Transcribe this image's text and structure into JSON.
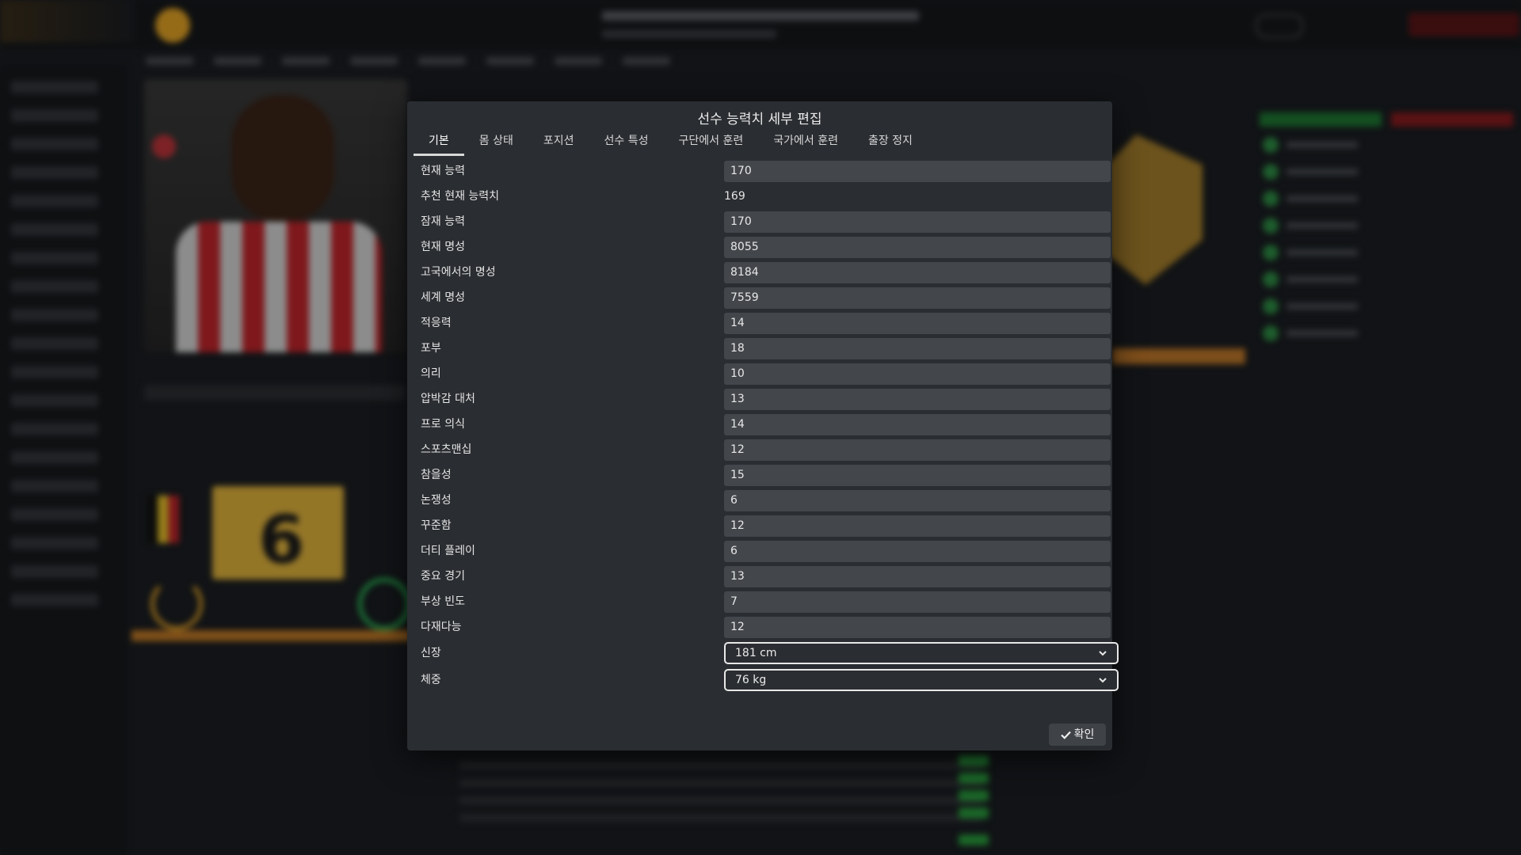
{
  "dialog": {
    "title": "선수 능력치 세부 편집",
    "tabs": [
      {
        "label": "기본",
        "active": true
      },
      {
        "label": "몸 상태",
        "active": false
      },
      {
        "label": "포지션",
        "active": false
      },
      {
        "label": "선수 특성",
        "active": false
      },
      {
        "label": "구단에서 훈련",
        "active": false
      },
      {
        "label": "국가에서 훈련",
        "active": false
      },
      {
        "label": "출장 정지",
        "active": false
      }
    ],
    "fields": [
      {
        "label": "현재 능력",
        "value": "170"
      },
      {
        "label": "추천 현재 능력치",
        "value": "169"
      },
      {
        "label": "잠재 능력",
        "value": "170"
      },
      {
        "label": "현재 명성",
        "value": "8055"
      },
      {
        "label": "고국에서의 명성",
        "value": "8184"
      },
      {
        "label": "세계 명성",
        "value": "7559"
      },
      {
        "label": "적응력",
        "value": "14"
      },
      {
        "label": "포부",
        "value": "18"
      },
      {
        "label": "의리",
        "value": "10"
      },
      {
        "label": "압박감 대처",
        "value": "13"
      },
      {
        "label": "프로 의식",
        "value": "14"
      },
      {
        "label": "스포츠맨십",
        "value": "12"
      },
      {
        "label": "참을성",
        "value": "15"
      },
      {
        "label": "논쟁성",
        "value": "6"
      },
      {
        "label": "꾸준함",
        "value": "12"
      },
      {
        "label": "더티 플레이",
        "value": "6"
      },
      {
        "label": "중요 경기",
        "value": "13"
      },
      {
        "label": "부상 빈도",
        "value": "7"
      },
      {
        "label": "다재다능",
        "value": "12"
      }
    ],
    "height": {
      "label": "신장",
      "value": "181 cm"
    },
    "weight": {
      "label": "체중",
      "value": "76 kg"
    },
    "confirm_label": "확인"
  },
  "background": {
    "shirt_number": "6"
  },
  "colors": {
    "accent_gold": "#e3b53d",
    "positive_green": "#2a9e3e",
    "negative_red": "#8a1d1f"
  }
}
